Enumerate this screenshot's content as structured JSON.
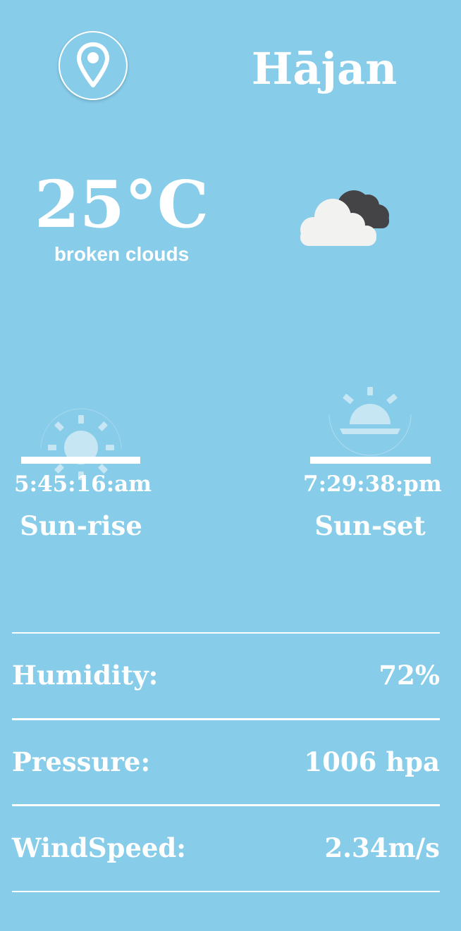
{
  "header": {
    "location_icon": "map-pin-icon",
    "city": "Hājan"
  },
  "current": {
    "temperature": "25°C",
    "description": "broken clouds",
    "weather_icon": "broken-clouds-icon"
  },
  "sun": {
    "sunrise_icon": "sunrise-icon",
    "sunrise_time": "5:45:16:am",
    "sunrise_label": "Sun-rise",
    "sunset_icon": "sunset-icon",
    "sunset_time": "7:29:38:pm",
    "sunset_label": "Sun-set"
  },
  "details": [
    {
      "label": "Humidity:",
      "value": "72%"
    },
    {
      "label": "Pressure:",
      "value": "1006 hpa"
    },
    {
      "label": "WindSpeed:",
      "value": "2.34m/s"
    }
  ],
  "colors": {
    "background": "#87CCE9",
    "text": "#FFFFFF",
    "cloud_light": "#F2F2F0",
    "cloud_dark": "#444447"
  }
}
